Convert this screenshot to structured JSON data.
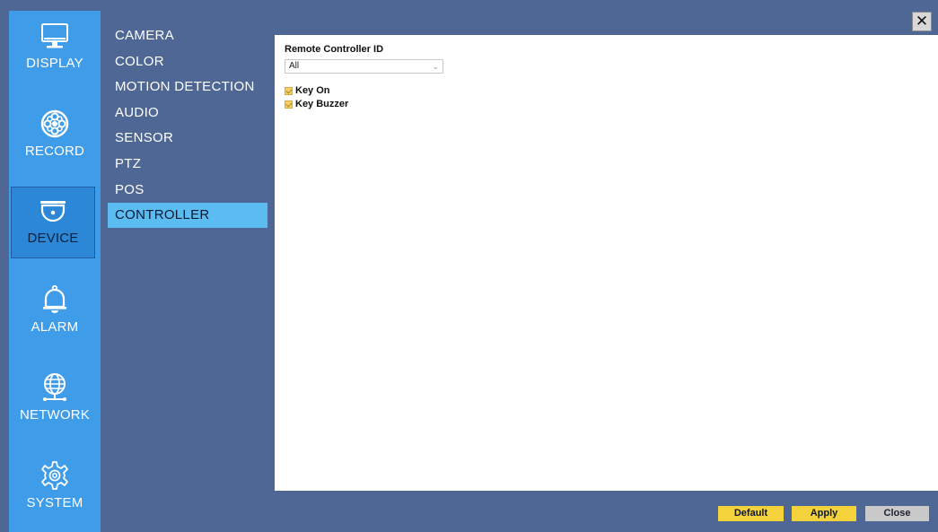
{
  "rail": {
    "items": [
      {
        "label": "DISPLAY",
        "icon": "monitor-icon"
      },
      {
        "label": "RECORD",
        "icon": "film-reel-icon"
      },
      {
        "label": "DEVICE",
        "icon": "dome-camera-icon",
        "active": true
      },
      {
        "label": "ALARM",
        "icon": "bell-icon"
      },
      {
        "label": "NETWORK",
        "icon": "globe-icon"
      },
      {
        "label": "SYSTEM",
        "icon": "gear-icon"
      }
    ]
  },
  "submenu": {
    "items": [
      {
        "label": "CAMERA"
      },
      {
        "label": "COLOR"
      },
      {
        "label": "MOTION DETECTION"
      },
      {
        "label": "AUDIO"
      },
      {
        "label": "SENSOR"
      },
      {
        "label": "PTZ"
      },
      {
        "label": "POS"
      },
      {
        "label": "CONTROLLER",
        "active": true
      }
    ]
  },
  "window": {
    "close_glyph": "✕"
  },
  "controller": {
    "remote_id_label": "Remote Controller ID",
    "remote_id_value": "All",
    "key_on_label": "Key On",
    "key_on_checked": true,
    "key_buzzer_label": "Key Buzzer",
    "key_buzzer_checked": true
  },
  "buttons": {
    "default_label": "Default",
    "apply_label": "Apply",
    "close_label": "Close"
  },
  "colors": {
    "frame_bg": "#4e6794",
    "rail_bg": "#3f9ce8",
    "submenu_active": "#5bbcf2",
    "button_yellow": "#f4d23b",
    "button_gray": "#c9c9c9"
  }
}
